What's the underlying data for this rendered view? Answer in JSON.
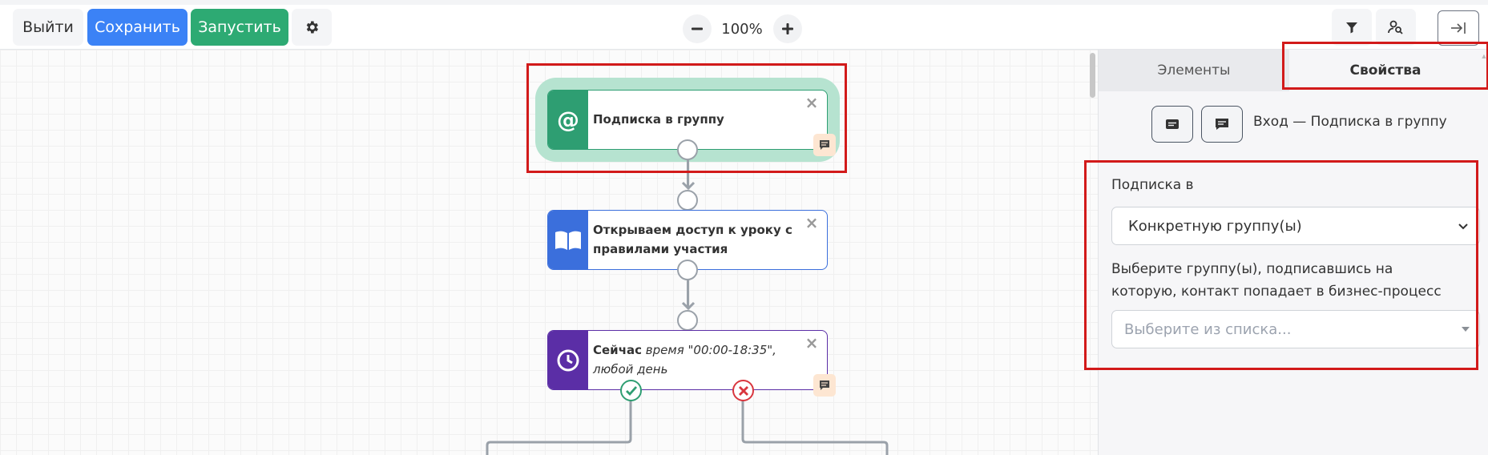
{
  "toolbar": {
    "exit_label": "Выйти",
    "save_label": "Сохранить",
    "run_label": "Запустить",
    "zoom_level": "100%"
  },
  "canvas": {
    "nodes": [
      {
        "title": "Подписка в группу",
        "icon": "at-sign-icon",
        "icon_color": "#2e9e72"
      },
      {
        "title": "Открываем доступ к уроку с правилами участия",
        "icon": "book-icon",
        "icon_color": "#3b6fdc"
      },
      {
        "title_bold": "Сейчас",
        "title_italic": "время \"00:00-18:35\", любой день",
        "icon": "clock-icon",
        "icon_color": "#5b2ea6"
      }
    ]
  },
  "panel": {
    "tabs": [
      {
        "label": "Элементы",
        "active": false
      },
      {
        "label": "Свойства",
        "active": true
      }
    ],
    "header_title": "Вход — Подписка в группу",
    "subscribe_label": "Подписка в",
    "subscribe_value": "Конкретную группу(ы)",
    "groups_label": "Выберите группу(ы), подписавшись на которую, контакт попадает в бизнес-процесс",
    "groups_placeholder": "Выберите из списка..."
  },
  "colors": {
    "save": "#3b82f6",
    "run": "#2daa73",
    "highlight": "#d21a1a",
    "success": "#2e9e72",
    "danger": "#d9363e"
  }
}
